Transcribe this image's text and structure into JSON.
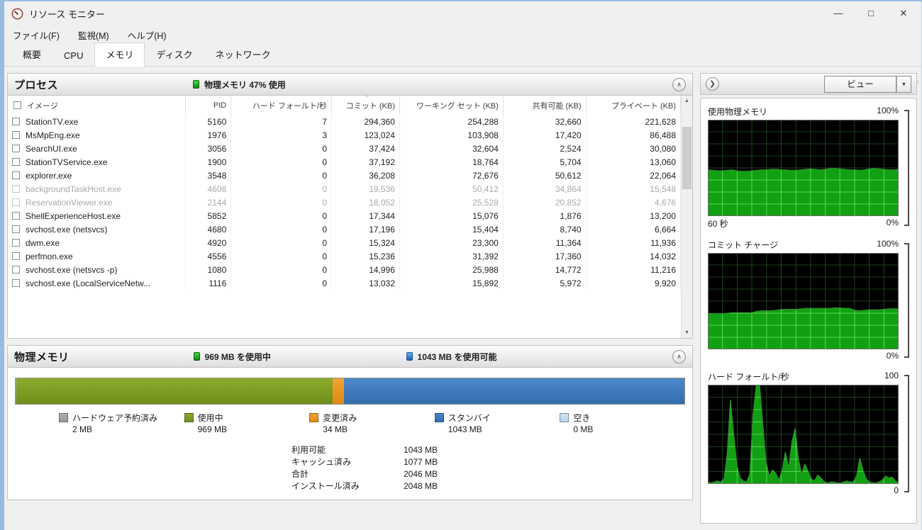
{
  "window": {
    "title": "リソース モニター",
    "controls": {
      "minimize": "—",
      "maximize": "□",
      "close": "✕"
    }
  },
  "menu": {
    "items": [
      "ファイル(F)",
      "監視(M)",
      "ヘルプ(H)"
    ]
  },
  "tabs": {
    "items": [
      {
        "label": "概要",
        "active": false
      },
      {
        "label": "CPU",
        "active": false
      },
      {
        "label": "メモリ",
        "active": true
      },
      {
        "label": "ディスク",
        "active": false
      },
      {
        "label": "ネットワーク",
        "active": false
      }
    ]
  },
  "processes": {
    "title": "プロセス",
    "status": "物理メモリ 47% 使用",
    "sort_glyph": "˄",
    "collapse_glyph": "∧",
    "columns": [
      "イメージ",
      "PID",
      "ハード フォールト/秒",
      "コミット (KB)",
      "ワーキング セット (KB)",
      "共有可能 (KB)",
      "プライベート (KB)"
    ],
    "rows": [
      {
        "image": "StationTV.exe",
        "pid": "5160",
        "hard_faults": "7",
        "commit": "294,360",
        "working_set": "254,288",
        "shareable": "32,660",
        "private": "221,628",
        "dimmed": false
      },
      {
        "image": "MsMpEng.exe",
        "pid": "1976",
        "hard_faults": "3",
        "commit": "123,024",
        "working_set": "103,908",
        "shareable": "17,420",
        "private": "86,488",
        "dimmed": false
      },
      {
        "image": "SearchUI.exe",
        "pid": "3056",
        "hard_faults": "0",
        "commit": "37,424",
        "working_set": "32,604",
        "shareable": "2,524",
        "private": "30,080",
        "dimmed": false
      },
      {
        "image": "StationTVService.exe",
        "pid": "1900",
        "hard_faults": "0",
        "commit": "37,192",
        "working_set": "18,764",
        "shareable": "5,704",
        "private": "13,060",
        "dimmed": false
      },
      {
        "image": "explorer.exe",
        "pid": "3548",
        "hard_faults": "0",
        "commit": "36,208",
        "working_set": "72,676",
        "shareable": "50,612",
        "private": "22,064",
        "dimmed": false
      },
      {
        "image": "backgroundTaskHost.exe",
        "pid": "4608",
        "hard_faults": "0",
        "commit": "19,536",
        "working_set": "50,412",
        "shareable": "34,864",
        "private": "15,548",
        "dimmed": true
      },
      {
        "image": "ReservationViewer.exe",
        "pid": "2144",
        "hard_faults": "0",
        "commit": "18,052",
        "working_set": "25,528",
        "shareable": "20,852",
        "private": "4,676",
        "dimmed": true
      },
      {
        "image": "ShellExperienceHost.exe",
        "pid": "5852",
        "hard_faults": "0",
        "commit": "17,344",
        "working_set": "15,076",
        "shareable": "1,876",
        "private": "13,200",
        "dimmed": false
      },
      {
        "image": "svchost.exe (netsvcs)",
        "pid": "4680",
        "hard_faults": "0",
        "commit": "17,196",
        "working_set": "15,404",
        "shareable": "8,740",
        "private": "6,664",
        "dimmed": false
      },
      {
        "image": "dwm.exe",
        "pid": "4920",
        "hard_faults": "0",
        "commit": "15,324",
        "working_set": "23,300",
        "shareable": "11,364",
        "private": "11,936",
        "dimmed": false
      },
      {
        "image": "perfmon.exe",
        "pid": "4556",
        "hard_faults": "0",
        "commit": "15,236",
        "working_set": "31,392",
        "shareable": "17,360",
        "private": "14,032",
        "dimmed": false
      },
      {
        "image": "svchost.exe (netsvcs -p)",
        "pid": "1080",
        "hard_faults": "0",
        "commit": "14,996",
        "working_set": "25,988",
        "shareable": "14,772",
        "private": "11,216",
        "dimmed": false
      },
      {
        "image": "svchost.exe (LocalServiceNetw...",
        "pid": "1116",
        "hard_faults": "0",
        "commit": "13,032",
        "working_set": "15,892",
        "shareable": "5,972",
        "private": "9,920",
        "dimmed": false
      }
    ]
  },
  "physical_memory": {
    "title": "物理メモリ",
    "used_label": "969 MB を使用中",
    "available_label": "1043 MB を使用可能",
    "collapse_glyph": "∧",
    "segments": [
      {
        "name": "ハードウェア予約済み",
        "value": "2 MB",
        "percent": 0.15,
        "color": "#b0b0b0",
        "color2": "#979797"
      },
      {
        "name": "使用中",
        "value": "969 MB",
        "percent": 47.3,
        "color": "#8cab2c",
        "color2": "#6f8f1b"
      },
      {
        "name": "変更済み",
        "value": "34 MB",
        "percent": 1.7,
        "color": "#f0a339",
        "color2": "#e08a10"
      },
      {
        "name": "スタンバイ",
        "value": "1043 MB",
        "percent": 50.85,
        "color": "#4c88ca",
        "color2": "#336fae"
      },
      {
        "name": "空き",
        "value": "0 MB",
        "percent": 0,
        "color": "#cfe3f5",
        "color2": "#b7d4ec"
      }
    ],
    "stats": [
      {
        "label": "利用可能",
        "value": "1043 MB"
      },
      {
        "label": "キャッシュ済み",
        "value": "1077 MB"
      },
      {
        "label": "合計",
        "value": "2046 MB"
      },
      {
        "label": "インストール済み",
        "value": "2048 MB"
      }
    ]
  },
  "sidebar": {
    "nav_glyph": "❯",
    "view_button": "ビュー",
    "dropdown_glyph": "▼"
  },
  "chart_data": [
    {
      "type": "area",
      "title": "使用物理メモリ",
      "ylim": [
        0,
        100
      ],
      "max_label": "100%",
      "min_label": "0%",
      "x_label": "60 秒",
      "x_span": "60 seconds",
      "grid": true,
      "fill_color": "#11a011",
      "values": [
        48,
        47.5,
        47,
        47,
        47.5,
        48,
        47,
        46.5,
        46.5,
        47,
        47.5,
        48,
        48,
        48.5,
        48.5,
        48,
        48,
        47.5,
        47.5,
        48,
        48.5,
        49,
        48.5,
        48,
        48.5,
        49.5,
        49.5,
        49,
        48.5,
        48,
        48,
        47.5,
        48,
        49,
        49.5,
        49,
        48.5,
        48,
        48,
        48.5
      ]
    },
    {
      "type": "area",
      "title": "コミット チャージ",
      "ylim": [
        0,
        100
      ],
      "max_label": "100%",
      "min_label": "0%",
      "x_label": "",
      "x_span": "60 seconds",
      "grid": true,
      "fill_color": "#11a011",
      "values": [
        37,
        37,
        37,
        37,
        37.5,
        38,
        38,
        38,
        38,
        38,
        39.5,
        40,
        40,
        40,
        40.5,
        41.5,
        41.5,
        41.5,
        41.5,
        42,
        42.5,
        42.5,
        42.5,
        42.5,
        42.5,
        42.5,
        43,
        43,
        42.5,
        42.5,
        40.5,
        40,
        40.5,
        41,
        41,
        41,
        41.5,
        42,
        42,
        42
      ]
    },
    {
      "type": "area",
      "title": "ハード フォールト/秒",
      "ylim": [
        0,
        100
      ],
      "max_label": "100",
      "min_label": "0",
      "x_label": "",
      "x_span": "60 seconds",
      "grid": true,
      "fill_color": "#11a011",
      "values": [
        2,
        1,
        2,
        3,
        2,
        5,
        30,
        85,
        50,
        18,
        6,
        3,
        2,
        10,
        70,
        100,
        100,
        60,
        22,
        8,
        14,
        11,
        4,
        14,
        32,
        16,
        42,
        56,
        26,
        10,
        20,
        13,
        5,
        3,
        9,
        6,
        2,
        1,
        2,
        2,
        1,
        1,
        2,
        3,
        2,
        2,
        8,
        26,
        14,
        5,
        2,
        1,
        1,
        2,
        4,
        8,
        6,
        7,
        3,
        1
      ]
    },
    {
      "type": "stacked_bar",
      "title": "物理メモリ構成",
      "unit": "MB",
      "segments": [
        {
          "name": "ハードウェア予約済み",
          "value": 2
        },
        {
          "name": "使用中",
          "value": 969
        },
        {
          "name": "変更済み",
          "value": 34
        },
        {
          "name": "スタンバイ",
          "value": 1043
        },
        {
          "name": "空き",
          "value": 0
        }
      ]
    }
  ]
}
